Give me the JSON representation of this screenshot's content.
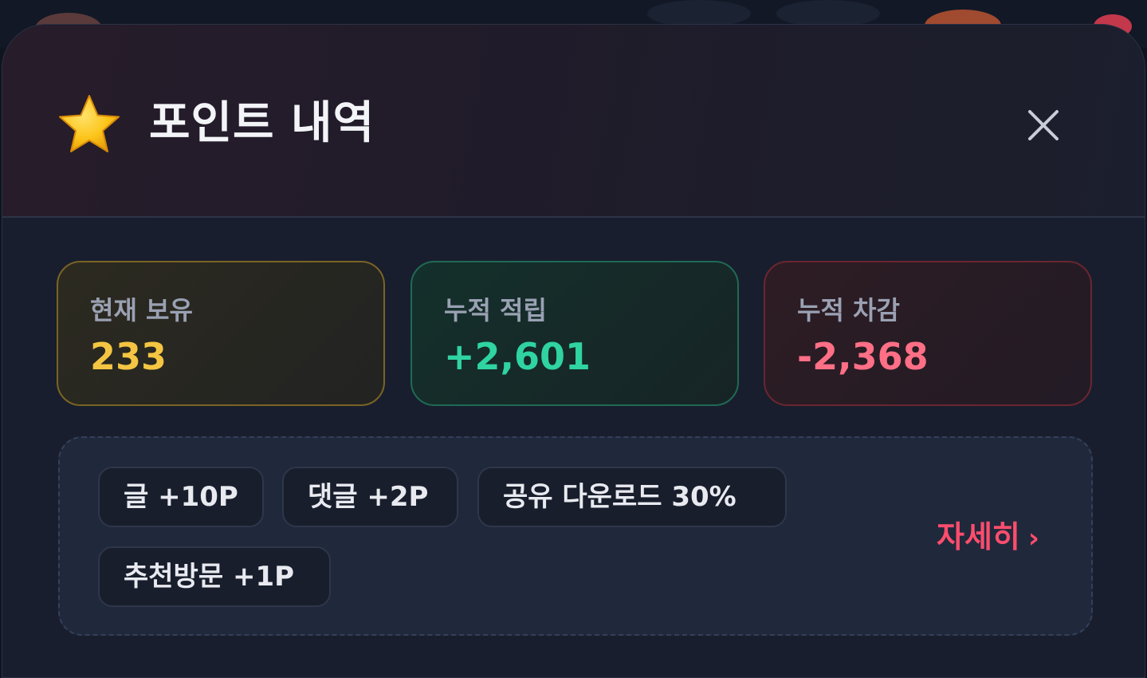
{
  "modal": {
    "title": "포인트 내역",
    "icons": {
      "title": "star-icon",
      "close": "close-icon"
    }
  },
  "stats": {
    "current": {
      "label": "현재 보유",
      "value": "233",
      "color": "#f4c542"
    },
    "earned": {
      "label": "누적 적립",
      "value": "+2,601",
      "color": "#2fd4a0"
    },
    "spent": {
      "label": "누적 차감",
      "value": "-2,368",
      "color": "#ff6f86"
    }
  },
  "rules": {
    "chips": [
      "글 +10P",
      "댓글 +2P",
      "공유 다운로드 30%",
      "추천방문 +1P"
    ],
    "details_label": "자세히",
    "details_chevron": "›",
    "accent": "#ff4d6d"
  }
}
